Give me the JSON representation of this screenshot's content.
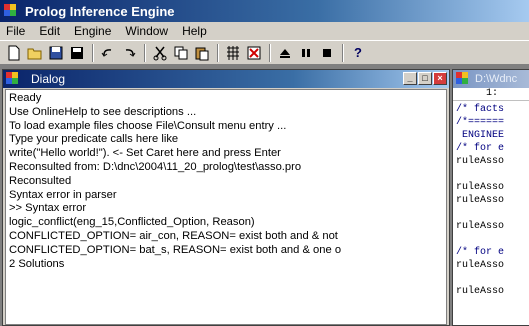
{
  "app": {
    "title": "Prolog Inference Engine"
  },
  "menu": {
    "items": [
      {
        "label": "File"
      },
      {
        "label": "Edit"
      },
      {
        "label": "Engine"
      },
      {
        "label": "Window"
      },
      {
        "label": "Help"
      }
    ]
  },
  "toolbar": {
    "icons": [
      "new-file-icon",
      "open-folder-icon",
      "save-icon",
      "save-as-icon",
      "undo-icon",
      "redo-icon",
      "cut-icon",
      "copy-icon",
      "paste-icon",
      "grid-icon",
      "stop-sign-icon",
      "eject-icon",
      "pause-icon",
      "stop-icon",
      "help-icon"
    ],
    "help_label": "?"
  },
  "dialog": {
    "title": "Dialog",
    "lines": [
      "Ready",
      "Use OnlineHelp to see descriptions ...",
      "To load example files choose File\\Consult menu entry ...",
      "Type your predicate calls here like",
      "write(\"Hello world!\").  <- Set Caret here and press Enter",
      "Reconsulted from: D:\\dnc\\2004\\11_20_prolog\\test\\asso.pro",
      "Reconsulted",
      "Syntax error in parser",
      ">> Syntax error",
      "logic_conflict(eng_15,Conflicted_Option, Reason)",
      "CONFLICTED_OPTION= air_con, REASON= exist both and & not",
      "CONFLICTED_OPTION= bat_s, REASON= exist both and & one o",
      "2 Solutions"
    ]
  },
  "editor": {
    "title": "D:\\Wdnc",
    "position": "1:",
    "lines": [
      {
        "text": "/* facts",
        "kind": "comment"
      },
      {
        "text": "/*======",
        "kind": "comment"
      },
      {
        "text": " ENGINEE",
        "kind": "comment"
      },
      {
        "text": "/* for e",
        "kind": "comment"
      },
      {
        "text": "ruleAsso",
        "kind": "plain"
      },
      {
        "text": "",
        "kind": "plain"
      },
      {
        "text": "ruleAsso",
        "kind": "plain"
      },
      {
        "text": "ruleAsso",
        "kind": "plain"
      },
      {
        "text": "",
        "kind": "plain"
      },
      {
        "text": "ruleAsso",
        "kind": "plain"
      },
      {
        "text": "",
        "kind": "plain"
      },
      {
        "text": "/* for e",
        "kind": "comment"
      },
      {
        "text": "ruleAsso",
        "kind": "plain"
      },
      {
        "text": "",
        "kind": "plain"
      },
      {
        "text": "ruleAsso",
        "kind": "plain"
      }
    ]
  }
}
